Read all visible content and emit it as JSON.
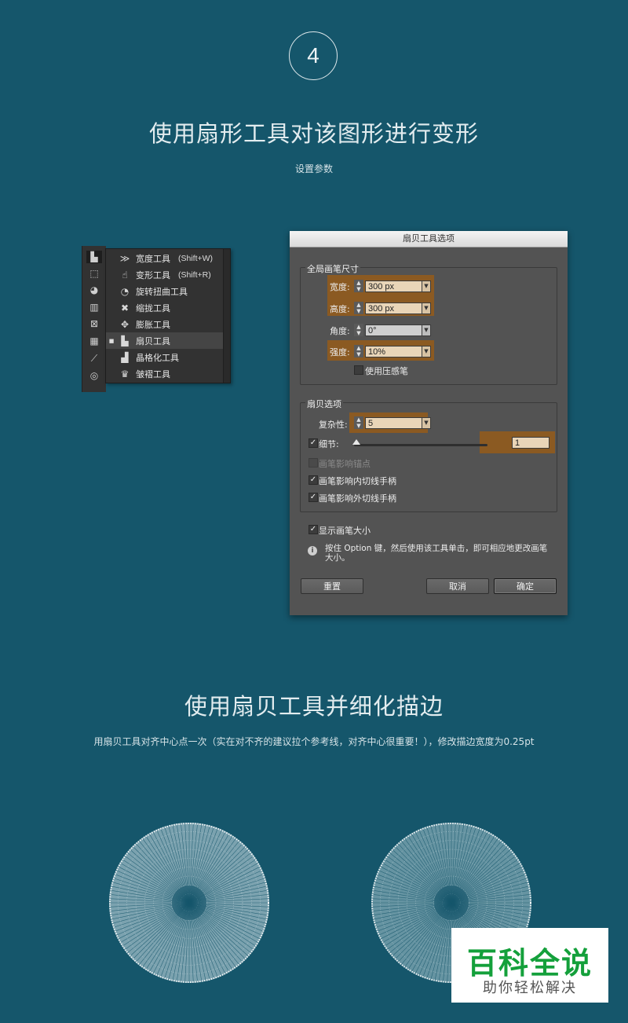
{
  "step": {
    "number": "4"
  },
  "section1": {
    "title": "使用扇形工具对该图形进行变形",
    "subtitle": "设置参数"
  },
  "section2": {
    "title": "使用扇贝工具并细化描边",
    "subtitle": "用扇贝工具对齐中心点一次（实在对不齐的建议拉个参考线，对齐中心很重要！），修改描边宽度为0.25pt"
  },
  "flyout": {
    "items": [
      {
        "icon": "width-tool-icon",
        "label": "宽度工具",
        "shortcut": "(Shift+W)"
      },
      {
        "icon": "warp-tool-icon",
        "label": "变形工具",
        "shortcut": "(Shift+R)"
      },
      {
        "icon": "twirl-tool-icon",
        "label": "旋转扭曲工具",
        "shortcut": ""
      },
      {
        "icon": "pucker-tool-icon",
        "label": "缩拢工具",
        "shortcut": ""
      },
      {
        "icon": "bloat-tool-icon",
        "label": "膨胀工具",
        "shortcut": ""
      },
      {
        "icon": "scallop-tool-icon",
        "label": "扇贝工具",
        "shortcut": ""
      },
      {
        "icon": "crystallize-tool-icon",
        "label": "晶格化工具",
        "shortcut": ""
      },
      {
        "icon": "wrinkle-tool-icon",
        "label": "皱褶工具",
        "shortcut": ""
      }
    ]
  },
  "dialog": {
    "title": "扇贝工具选项",
    "brush_group": {
      "title": "全局画笔尺寸",
      "width_label": "宽度:",
      "width_value": "300 px",
      "height_label": "高度:",
      "height_value": "300 px",
      "angle_label": "角度:",
      "angle_value": "0°",
      "intensity_label": "强度:",
      "intensity_value": "10%",
      "pressure_label": "使用压感笔"
    },
    "scallop_group": {
      "title": "扇贝选项",
      "complexity_label": "复杂性:",
      "complexity_value": "5",
      "detail_label": "细节:",
      "detail_value": "1",
      "brush_anchor_label": "画笔影响锚点",
      "brush_in_label": "画笔影响内切线手柄",
      "brush_out_label": "画笔影响外切线手柄"
    },
    "show_size_label": "显示画笔大小",
    "note_line1": "按住 Option 键，然后使用该工具单击，即可相应地更改画笔",
    "note_line2": "大小。",
    "reset_button": "重置",
    "cancel_button": "取消",
    "ok_button": "确定"
  },
  "watermark": {
    "big": "百科全说",
    "small": "助你轻松解决"
  },
  "colors": {
    "background": "#15566b",
    "highlight": "#8b5a22",
    "field": "#e9d5b8",
    "watermark_green": "#14a03b"
  }
}
